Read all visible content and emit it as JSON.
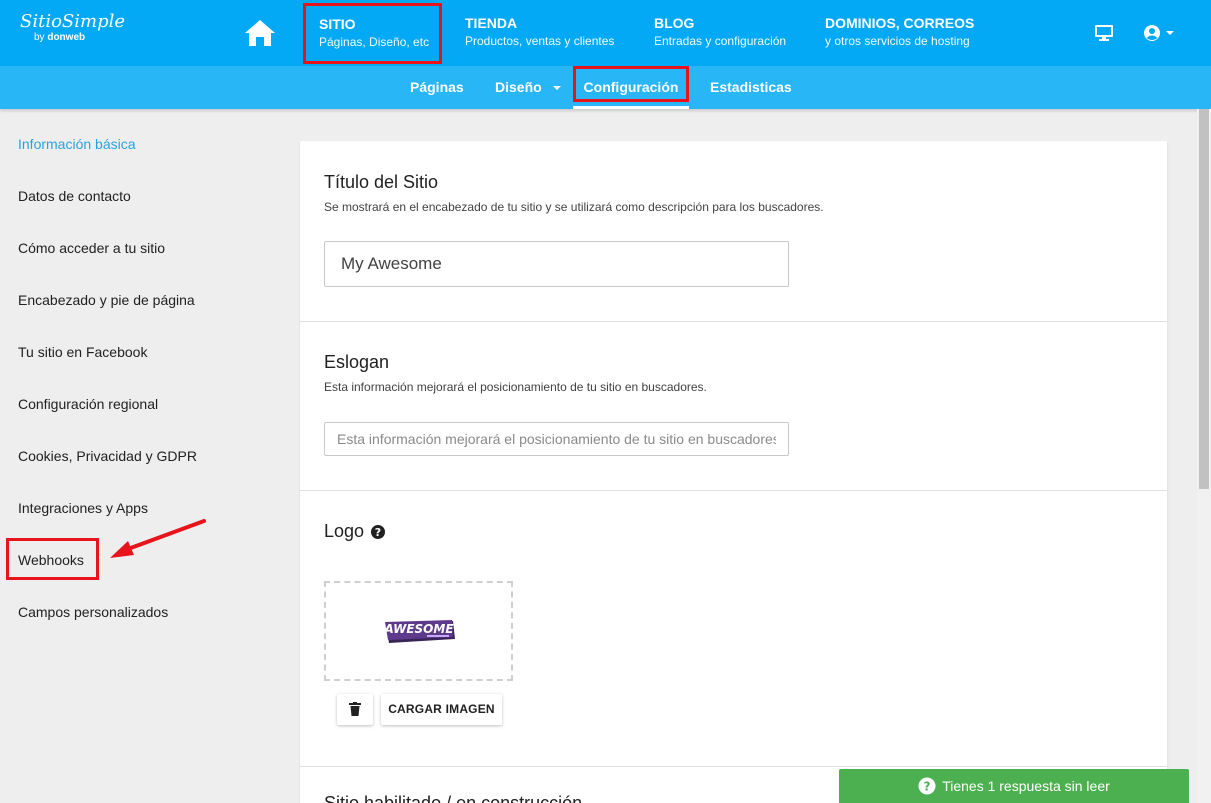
{
  "header": {
    "brand": "SitioSimple",
    "brand_by": "by",
    "brand_by_company": "donweb",
    "home_icon": "home-icon",
    "nav": [
      {
        "title": "SITIO",
        "subtitle": "Páginas, Diseño, etc"
      },
      {
        "title": "TIENDA",
        "subtitle": "Productos, ventas y clientes"
      },
      {
        "title": "BLOG",
        "subtitle": "Entradas y configuración"
      },
      {
        "title": "DOMINIOS, CORREOS",
        "subtitle": "y otros servicios de hosting"
      }
    ],
    "preview_icon": "monitor-icon",
    "user_icon": "user-circle-icon"
  },
  "subnav": {
    "items": [
      "Páginas",
      "Diseño",
      "Configuración",
      "Estadisticas"
    ],
    "active": "Configuración"
  },
  "sidebar": {
    "items": [
      "Información básica",
      "Datos de contacto",
      "Cómo acceder a tu sitio",
      "Encabezado y pie de página",
      "Tu sitio en Facebook",
      "Configuración regional",
      "Cookies, Privacidad y GDPR",
      "Integraciones y Apps",
      "Webhooks",
      "Campos personalizados"
    ],
    "active": "Información básica"
  },
  "main": {
    "site_title": {
      "label": "Título del Sitio",
      "description": "Se mostrará en el encabezado de tu sitio y se utilizará como descripción para los buscadores.",
      "value": "My Awesome"
    },
    "slogan": {
      "label": "Eslogan",
      "description": "Esta información mejorará el posicionamiento de tu sitio en buscadores.",
      "placeholder": "Esta información mejorará el posicionamiento de tu sitio en buscadores."
    },
    "logo": {
      "label": "Logo",
      "logo_text": "AWESOME",
      "delete_icon": "trash-icon",
      "upload_label": "CARGAR IMAGEN"
    },
    "next_section_title": "Sitio habilitado / en construcción"
  },
  "toast": {
    "text": "Tienes 1 respuesta sin leer",
    "icon": "question-circle-icon"
  },
  "colors": {
    "topbar": "#03a9f4",
    "subbar": "#29b6f6",
    "highlight": "#e8131b",
    "active_link": "#29a3e0",
    "toast": "#4caf50"
  }
}
